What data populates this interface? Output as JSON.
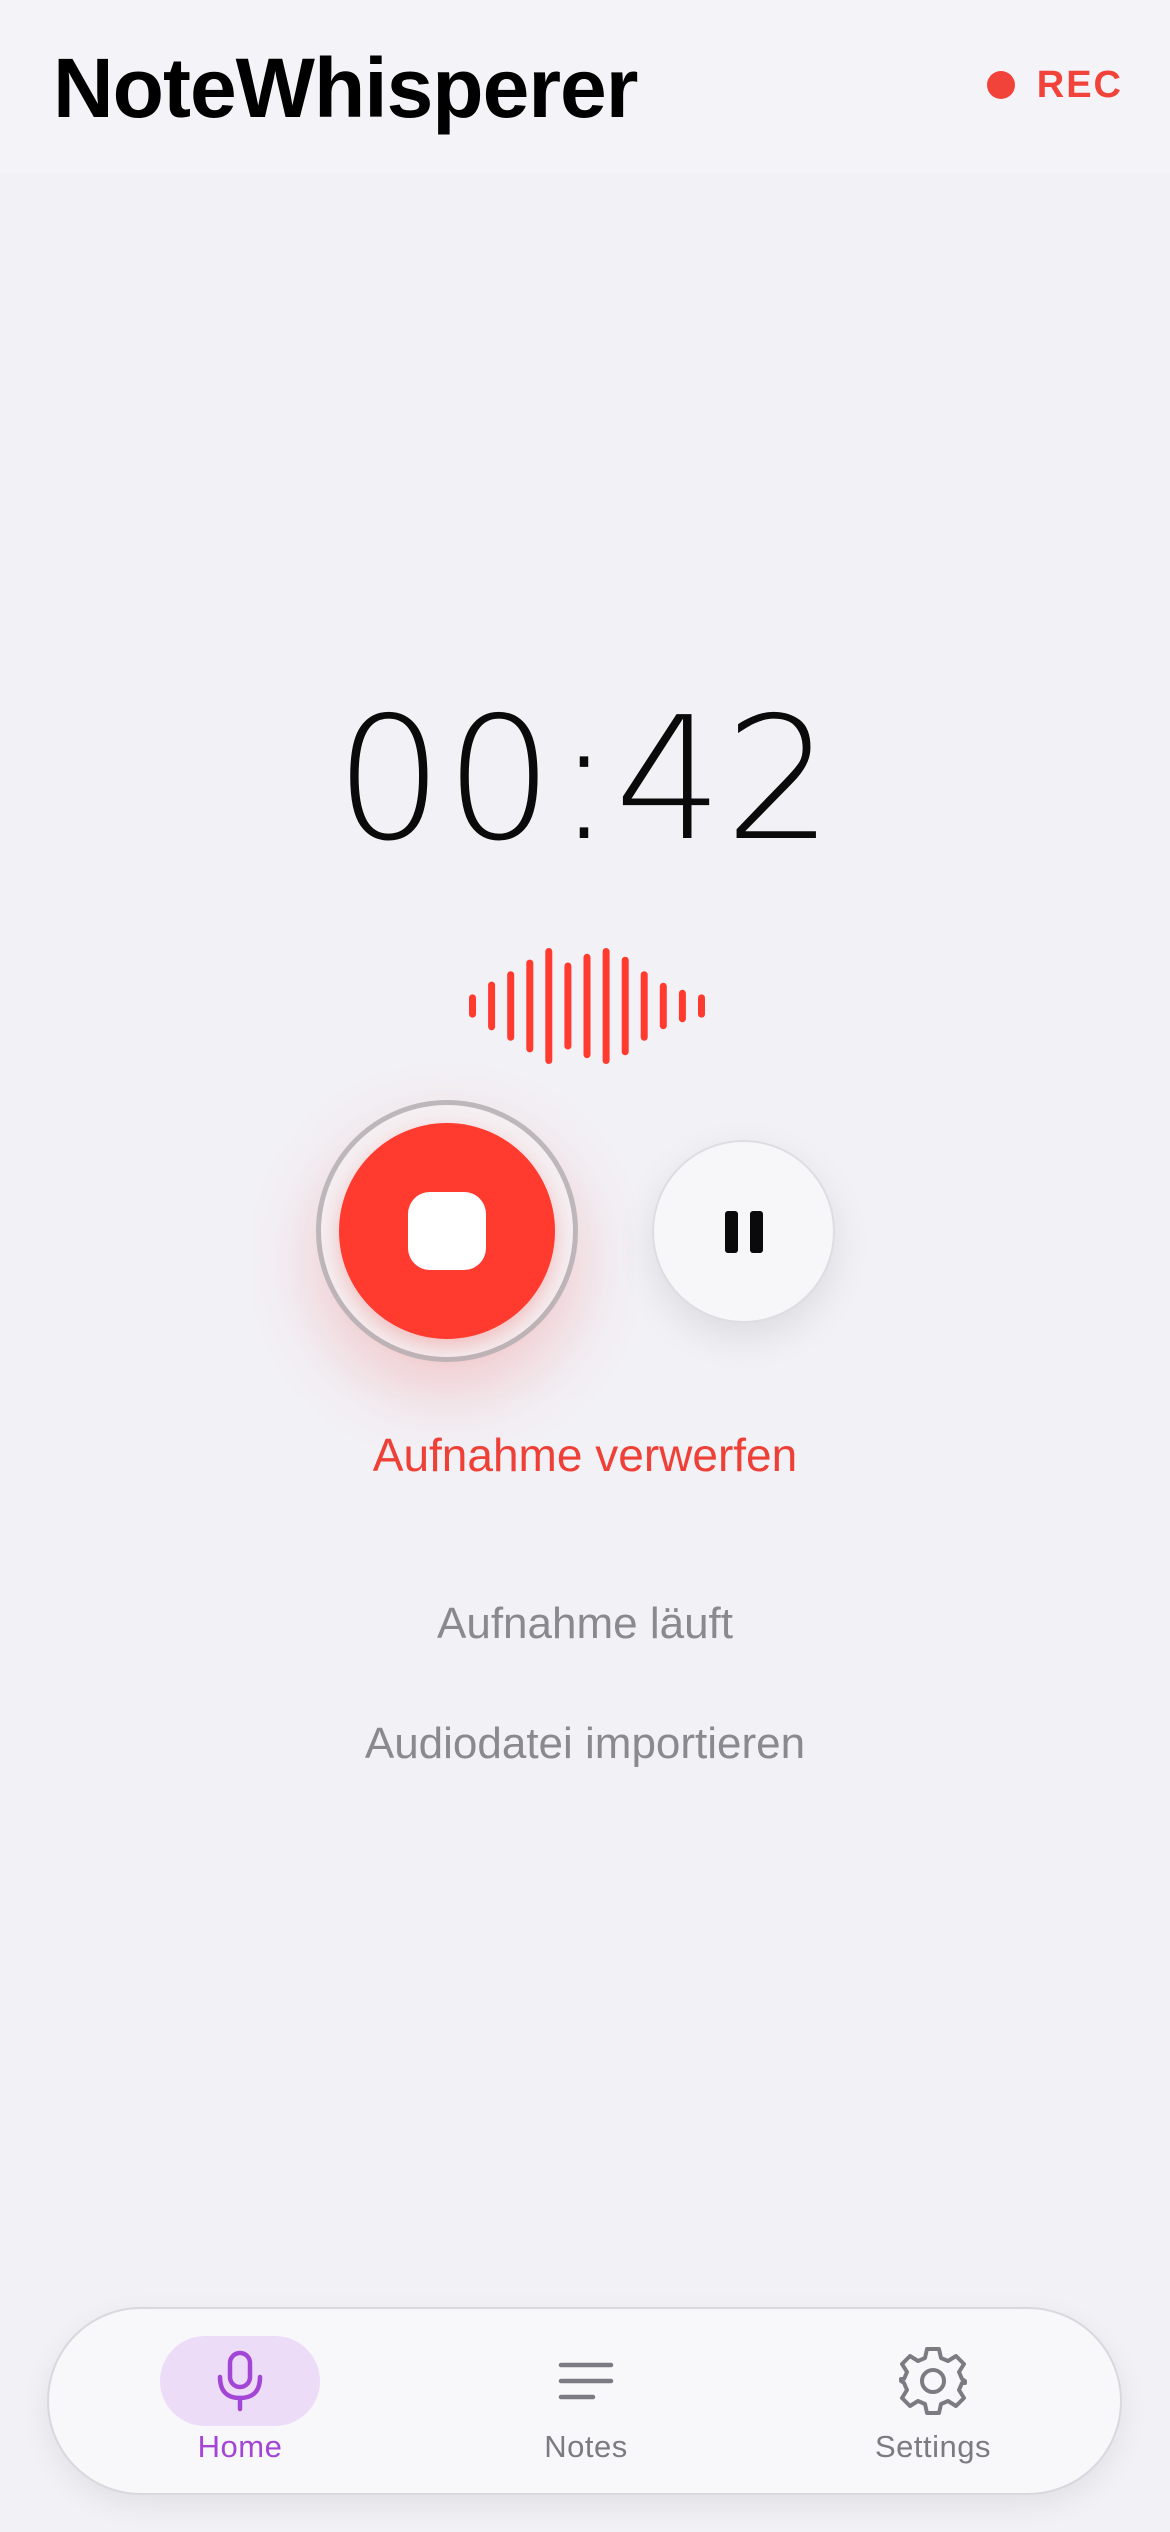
{
  "header": {
    "title": "NoteWhisperer",
    "rec_label": "REC"
  },
  "recorder": {
    "elapsed": "00:42",
    "discard_label": "Aufnahme verwerfen",
    "status_text": "Aufnahme läuft",
    "import_label": "Audiodatei importieren",
    "waveform_levels": [
      0.2,
      0.42,
      0.6,
      0.8,
      1.0,
      0.75,
      0.9,
      1.0,
      0.85,
      0.6,
      0.4,
      0.28,
      0.2
    ]
  },
  "tabbar": {
    "tabs": [
      {
        "label": "Home",
        "icon": "mic-icon",
        "active": true
      },
      {
        "label": "Notes",
        "icon": "list-icon",
        "active": false
      },
      {
        "label": "Settings",
        "icon": "gear-icon",
        "active": false
      }
    ]
  },
  "colors": {
    "accent_red": "#ff3b30",
    "tab_active": "#a346d6",
    "tab_active_bg": "#ecdcf7",
    "muted_text": "#8a8990"
  }
}
